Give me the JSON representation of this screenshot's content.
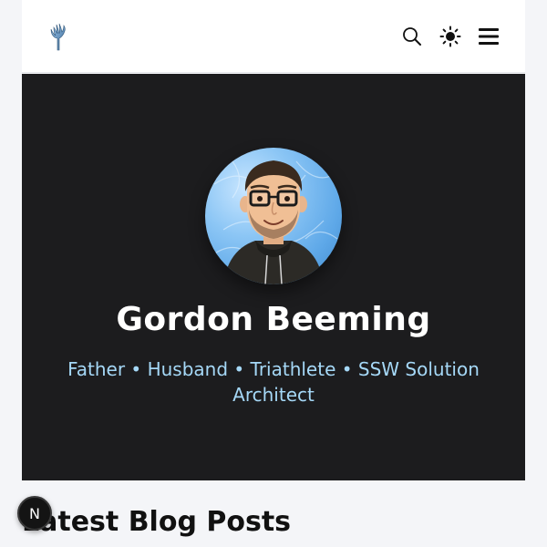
{
  "header": {
    "logo_icon": "tree-logo-icon",
    "actions": {
      "search_icon": "search-icon",
      "theme_icon": "sun-icon",
      "menu_icon": "hamburger-menu-icon"
    }
  },
  "hero": {
    "name": "Gordon Beeming",
    "tagline": "Father • Husband • Triathlete • SSW Solution Architect",
    "avatar_icon": "avatar-illustration"
  },
  "latest": {
    "title": "Latest Blog Posts"
  },
  "dev_indicator": {
    "label": "N"
  },
  "colors": {
    "hero_bg": "#1c1c1e",
    "tagline": "#a5d8f7",
    "page_bg": "#f4f5f8"
  }
}
